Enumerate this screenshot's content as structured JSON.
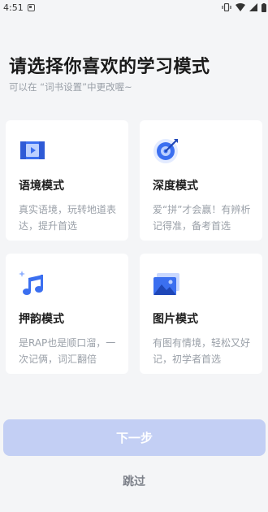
{
  "status_bar": {
    "time": "4:51"
  },
  "header": {
    "title": "请选择你喜欢的学习模式",
    "subtitle": "可以在 “词书设置”中更改喔~"
  },
  "modes": [
    {
      "title": "语境模式",
      "description": "真实语境，玩转地道表达，提升首选",
      "icon": "video-context-icon"
    },
    {
      "title": "深度模式",
      "description": "爱“拼”才会赢！有辨析记得准，备考首选",
      "icon": "target-icon"
    },
    {
      "title": "押韵模式",
      "description": "是RAP也是顺口溜，一次记俩，词汇翻倍",
      "icon": "music-note-icon"
    },
    {
      "title": "图片模式",
      "description": "有图有情境，轻松又好记，初学者首选",
      "icon": "picture-icon"
    }
  ],
  "actions": {
    "next_label": "下一步",
    "skip_label": "跳过"
  },
  "colors": {
    "primary_blue": "#3b6ff0",
    "button_disabled": "#c3cff4",
    "background": "#f4f5f7"
  }
}
